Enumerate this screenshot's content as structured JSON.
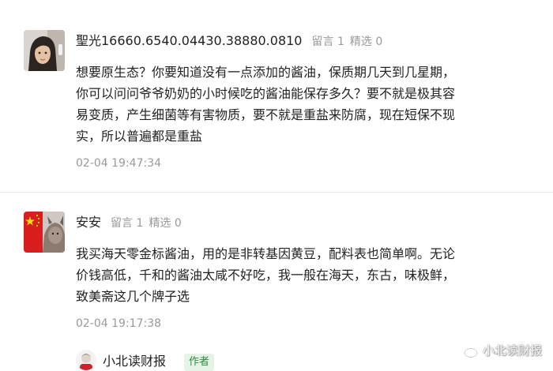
{
  "comments": [
    {
      "username": "聖光16660.6540.04430.38880.0810",
      "reply_label": "留言",
      "reply_count": "1",
      "featured_label": "精选",
      "featured_count": "0",
      "lines": [
        "想要原生态？你要知道没有一点添加的酱油，保质期几天到几星期，",
        "你可以问问爷爷奶奶的小时候吃的酱油能保存多久？要不就是极其容",
        "易变质，产生细菌等有害物质，要不就是重盐来防腐，现在短保不现",
        "实，所以普遍都是重盐"
      ],
      "time": "02-04 19:47:34"
    },
    {
      "username": "安安",
      "reply_label": "留言",
      "reply_count": "1",
      "featured_label": "精选",
      "featured_count": "0",
      "lines": [
        "我买海天零金标酱油，用的是非转基因黄豆，配料表也简单啊。无论",
        "价钱高低，千和的酱油太咸不好吃，我一般在海天，东古，味极鲜，",
        "致美斋这几个牌子选"
      ],
      "time": "02-04 19:17:38"
    }
  ],
  "reply": {
    "name": "小北读财报",
    "badge": "作者"
  },
  "watermark": "小北读财报",
  "colors": {
    "text": "#222222",
    "meta": "#9a9a9a",
    "divider": "#ececec",
    "author_badge_text": "#2e8b3a",
    "author_badge_bg": "#e6f4e8"
  }
}
